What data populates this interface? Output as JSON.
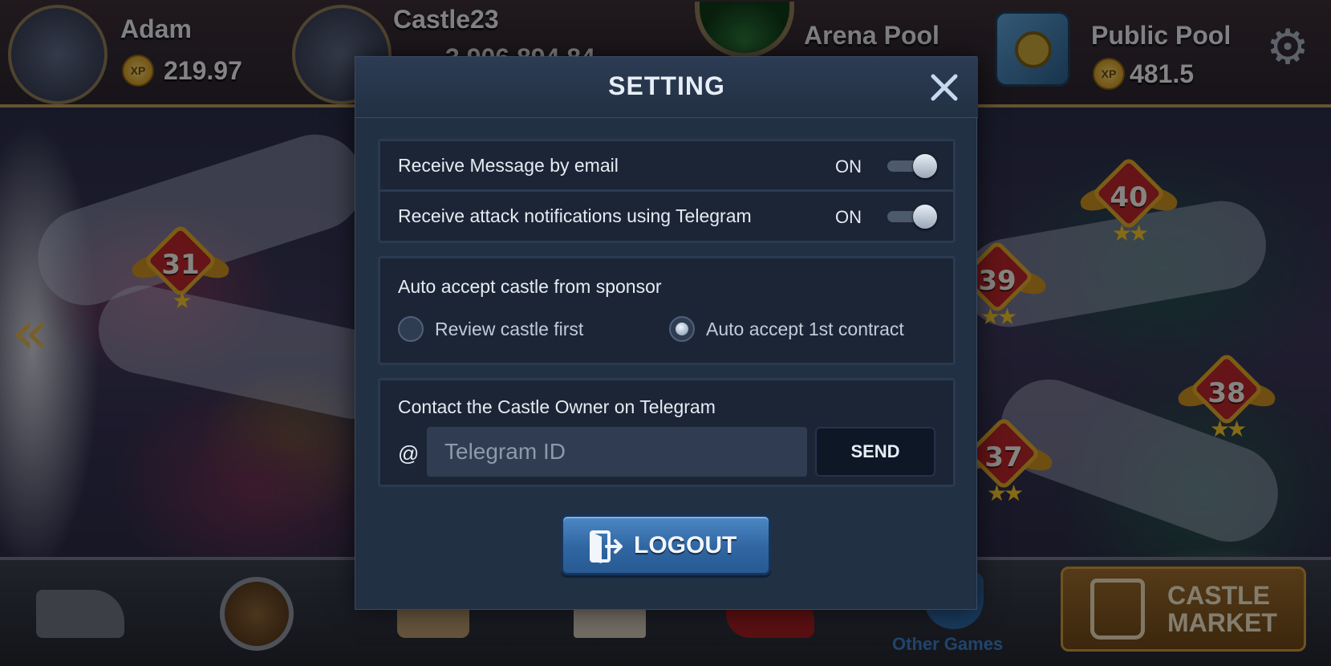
{
  "hud": {
    "player": {
      "name": "Adam",
      "xp_badge": "XP",
      "xp": "219.97"
    },
    "castle": {
      "name": "Castle23",
      "value": "3,906,894.84"
    },
    "arena_pool": {
      "label": "Arena Pool"
    },
    "public_pool": {
      "label": "Public Pool",
      "xp_badge": "XP",
      "value": "481.5"
    },
    "settings_icon": "gear-icon"
  },
  "map": {
    "levels": [
      {
        "num": "31",
        "stars": "★"
      },
      {
        "num": "40",
        "stars": "★★"
      },
      {
        "num": "39",
        "stars": "★★"
      },
      {
        "num": "38",
        "stars": "★★"
      },
      {
        "num": "37",
        "stars": "★★"
      }
    ],
    "back_arrows": "«"
  },
  "bottom": {
    "other_games": "Other Games",
    "castle_market_line1": "CASTLE",
    "castle_market_line2": "MARKET"
  },
  "modal": {
    "title": "SETTING",
    "close_icon": "close-icon",
    "notifications": [
      {
        "label": "Receive Message by email",
        "state": "ON"
      },
      {
        "label": "Receive attack notifications using Telegram",
        "state": "ON"
      }
    ],
    "auto_accept": {
      "title": "Auto accept castle from sponsor",
      "options": [
        {
          "label": "Review castle first",
          "selected": false
        },
        {
          "label": "Auto accept 1st contract",
          "selected": true
        }
      ]
    },
    "contact": {
      "title": "Contact the Castle Owner on Telegram",
      "at": "@",
      "placeholder": "Telegram ID",
      "send_label": "SEND"
    },
    "logout_label": "LOGOUT"
  },
  "colors": {
    "modal_bg": "#223043",
    "panel_bg": "#1b2536",
    "logout_blue": "#2f66a2",
    "hud_gold": "#b6995a"
  }
}
